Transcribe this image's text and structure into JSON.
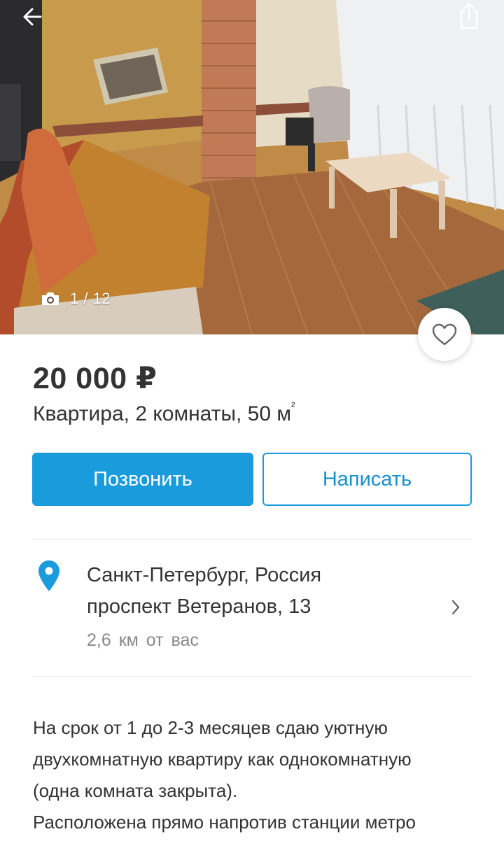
{
  "photo": {
    "counter": "1 / 12",
    "icons": {
      "back": "arrow-left-icon",
      "share": "share-icon",
      "camera": "camera-icon",
      "favorite": "heart-icon"
    }
  },
  "listing": {
    "price": "20 000 ₽",
    "subtitle_text": "Квартира, 2 комнаты, 50 м",
    "subtitle_sup": "²"
  },
  "actions": {
    "call_label": "Позвонить",
    "write_label": "Написать"
  },
  "address": {
    "city": "Санкт-Петербург, Россия",
    "street": "проспект Ветеранов, 13",
    "distance": "2,6 км от вас",
    "icons": {
      "pin": "location-pin-icon",
      "chevron": "chevron-right-icon"
    }
  },
  "description": {
    "line1": "На срок от 1 до 2-3 месяцев сдаю уютную",
    "line2": "двухкомнатную квартиру как однокомнатную",
    "line3": "(одна комната закрыта).",
    "line4": "Расположена прямо напротив станции метро"
  },
  "colors": {
    "accent": "#1a9bdc",
    "text": "#333333",
    "muted": "#888888",
    "divider": "#e3e3e3"
  }
}
